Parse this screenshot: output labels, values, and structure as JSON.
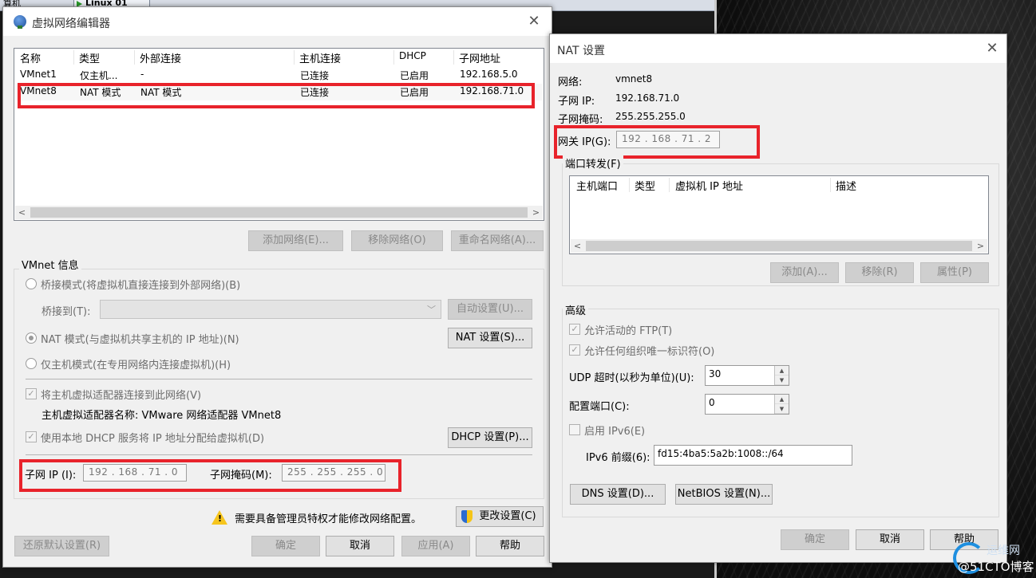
{
  "taskbar": {
    "tab_a": "算机",
    "tab_b": "Linux 01"
  },
  "vne": {
    "title": "虚拟网络编辑器",
    "columns": [
      "名称",
      "类型",
      "外部连接",
      "主机连接",
      "DHCP",
      "子网地址"
    ],
    "rows": [
      [
        "VMnet1",
        "仅主机...",
        "-",
        "已连接",
        "已启用",
        "192.168.5.0"
      ],
      [
        "VMnet8",
        "NAT 模式",
        "NAT 模式",
        "已连接",
        "已启用",
        "192.168.71.0"
      ]
    ],
    "buttons": {
      "add_network": "添加网络(E)...",
      "remove_network": "移除网络(O)",
      "rename_network": "重命名网络(A)..."
    },
    "info_title": "VMnet 信息",
    "bridge_mode": "桥接模式(将虚拟机直接连接到外部网络)(B)",
    "bridge_to": "桥接到(T):",
    "auto_settings": "自动设置(U)...",
    "nat_mode": "NAT 模式(与虚拟机共享主机的 IP 地址)(N)",
    "nat_settings": "NAT 设置(S)...",
    "host_only_mode": "仅主机模式(在专用网络内连接虚拟机)(H)",
    "connect_adapter": "将主机虚拟适配器连接到此网络(V)",
    "adapter_name": "主机虚拟适配器名称: VMware 网络适配器 VMnet8",
    "use_dhcp": "使用本地 DHCP 服务将 IP 地址分配给虚拟机(D)",
    "dhcp_settings": "DHCP 设置(P)...",
    "subnet_ip_label": "子网 IP (I):",
    "subnet_ip": "192 . 168 . 71 . 0",
    "subnet_mask_label": "子网掩码(M):",
    "subnet_mask": "255 . 255 . 255 . 0",
    "admin_note": "需要具备管理员特权才能修改网络配置。",
    "change_settings": "更改设置(C)",
    "restore_defaults": "还原默认设置(R)",
    "ok": "确定",
    "cancel": "取消",
    "apply": "应用(A)",
    "help": "帮助"
  },
  "nat": {
    "title": "NAT 设置",
    "network_label": "网络:",
    "network": "vmnet8",
    "subnet_ip_label": "子网 IP:",
    "subnet_ip": "192.168.71.0",
    "subnet_mask_label": "子网掩码:",
    "subnet_mask": "255.255.255.0",
    "gateway_label": "网关 IP(G):",
    "gateway": "192 . 168 . 71 . 2",
    "port_forward_title": "端口转发(F)",
    "pf_columns": [
      "主机端口",
      "类型",
      "虚拟机 IP 地址",
      "描述"
    ],
    "pf_add": "添加(A)...",
    "pf_remove": "移除(R)",
    "pf_props": "属性(P)",
    "advanced_title": "高级",
    "allow_ftp": "允许活动的 FTP(T)",
    "allow_oui": "允许任何组织唯一标识符(O)",
    "udp_timeout_label": "UDP 超时(以秒为单位)(U):",
    "udp_timeout": "30",
    "config_port_label": "配置端口(C):",
    "config_port": "0",
    "enable_ipv6": "启用 IPv6(E)",
    "ipv6_prefix_label": "IPv6 前缀(6):",
    "ipv6_prefix": "fd15:4ba5:5a2b:1008::/64",
    "dns_settings": "DNS 设置(D)...",
    "netbios_settings": "NetBIOS 设置(N)...",
    "ok": "确定",
    "cancel": "取消",
    "help": "帮助"
  },
  "watermark": {
    "line1": "运维网",
    "line2": "@51CTO博客"
  }
}
